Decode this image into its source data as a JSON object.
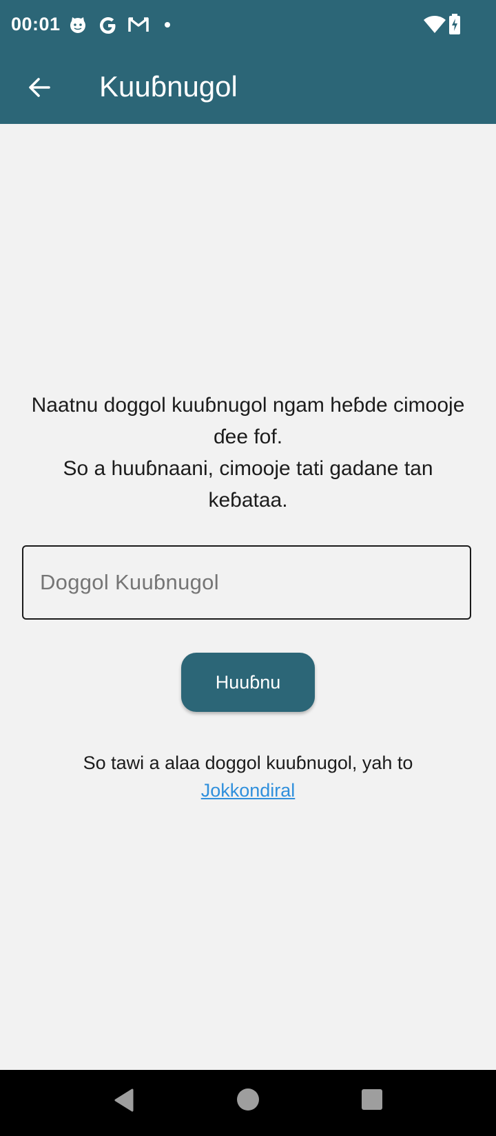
{
  "status_bar": {
    "time": "00:01",
    "notification_icons": [
      "cat-face-icon",
      "google-g-icon",
      "gmail-m-icon",
      "dot-icon"
    ],
    "system_icons": [
      "wifi-icon",
      "battery-charging-icon"
    ]
  },
  "app_bar": {
    "back_icon": "arrow-left-icon",
    "title": "Kuuɓnugol"
  },
  "main": {
    "intro_line1": "Naatnu doggol kuuɓnugol ngam heɓde cimooje ɗee fof.",
    "intro_line2": "So a huuɓnaani, cimooje tati gadane tan keɓataa.",
    "code_input": {
      "value": "Doggol Kuuɓnugol",
      "placeholder": "Doggol Kuuɓnugol"
    },
    "submit_label": "Huuɓnu",
    "footer_text": "So tawi a alaa doggol kuuɓnugol, yah to",
    "footer_link": "Jokkondiral"
  },
  "nav_bar": {
    "buttons": [
      "back-triangle-icon",
      "home-circle-icon",
      "recents-square-icon"
    ]
  },
  "colors": {
    "primary": "#2c6677",
    "background": "#f2f2f2",
    "link": "#2f8fdc",
    "nav_bar": "#000000"
  }
}
